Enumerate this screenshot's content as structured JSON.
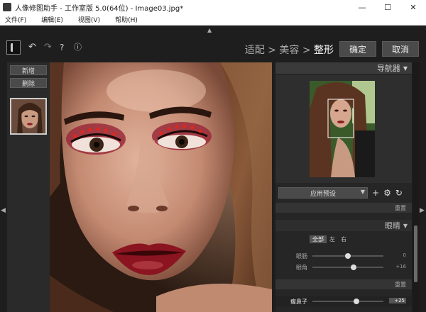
{
  "window": {
    "title": "人像修图助手 - 工作室版 5.0(64位) - Image03.jpg*",
    "minimize": "—",
    "maximize": "☐",
    "close": "✕"
  },
  "menu": [
    "文件(F)",
    "编辑(E)",
    "视图(V)",
    "帮助(H)"
  ],
  "toolbar": {
    "steps": [
      "适配",
      "美容",
      "整形"
    ],
    "separator": ">",
    "confirm_label": "确定",
    "cancel_label": "取消"
  },
  "left_panel": {
    "new_label": "新增",
    "delete_label": "删除"
  },
  "navigator": {
    "title": "导航器"
  },
  "presets": {
    "selected": "应用预设"
  },
  "reset_label": "重置",
  "eyes_section": {
    "title": "眼睛",
    "segments": [
      "全部",
      "左",
      "右"
    ],
    "sliders": [
      {
        "label": "眼肠",
        "value": "0",
        "level": 0.5
      },
      {
        "label": "眼角",
        "value": "+16",
        "level": 0.58
      }
    ]
  },
  "nose_slider": {
    "label": "瘦鼻子",
    "value": "+25",
    "level": 0.62
  },
  "colors": {
    "accent": "#4a4a4a",
    "panel": "#262626"
  }
}
